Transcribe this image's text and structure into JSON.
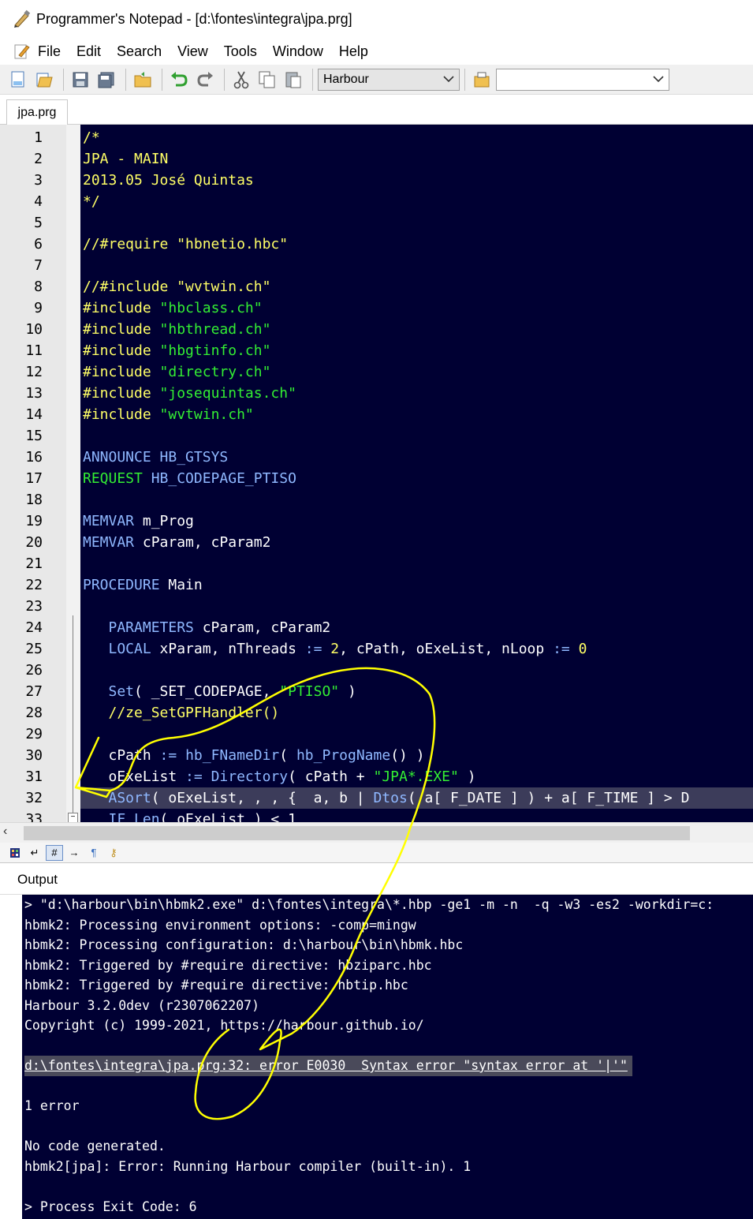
{
  "window": {
    "title": "Programmer's Notepad - [d:\\fontes\\integra\\jpa.prg]"
  },
  "menu": {
    "items": [
      "File",
      "Edit",
      "Search",
      "View",
      "Tools",
      "Window",
      "Help"
    ]
  },
  "toolbar": {
    "scheme_select": "Harbour",
    "second_select": ""
  },
  "tabs": [
    {
      "label": "jpa.prg"
    }
  ],
  "editor": {
    "lines": [
      {
        "n": "1",
        "parts": [
          {
            "t": "/*",
            "c": "comment"
          }
        ]
      },
      {
        "n": "2",
        "parts": [
          {
            "t": "JPA - MAIN",
            "c": "comment"
          }
        ]
      },
      {
        "n": "3",
        "parts": [
          {
            "t": "2013.05 José Quintas",
            "c": "comment"
          }
        ]
      },
      {
        "n": "4",
        "parts": [
          {
            "t": "*/",
            "c": "comment"
          }
        ]
      },
      {
        "n": "5",
        "parts": []
      },
      {
        "n": "6",
        "parts": [
          {
            "t": "//#require \"hbnetio.hbc\"",
            "c": "comment"
          }
        ]
      },
      {
        "n": "7",
        "parts": []
      },
      {
        "n": "8",
        "parts": [
          {
            "t": "//#include \"wvtwin.ch\"",
            "c": "comment"
          }
        ]
      },
      {
        "n": "9",
        "parts": [
          {
            "t": "#include ",
            "c": "comment"
          },
          {
            "t": "\"hbclass.ch\"",
            "c": "str"
          }
        ]
      },
      {
        "n": "10",
        "parts": [
          {
            "t": "#include ",
            "c": "comment"
          },
          {
            "t": "\"hbthread.ch\"",
            "c": "str"
          }
        ]
      },
      {
        "n": "11",
        "parts": [
          {
            "t": "#include ",
            "c": "comment"
          },
          {
            "t": "\"hbgtinfo.ch\"",
            "c": "str"
          }
        ]
      },
      {
        "n": "12",
        "parts": [
          {
            "t": "#include ",
            "c": "comment"
          },
          {
            "t": "\"directry.ch\"",
            "c": "str"
          }
        ]
      },
      {
        "n": "13",
        "parts": [
          {
            "t": "#include ",
            "c": "comment"
          },
          {
            "t": "\"josequintas.ch\"",
            "c": "str"
          }
        ]
      },
      {
        "n": "14",
        "parts": [
          {
            "t": "#include ",
            "c": "comment"
          },
          {
            "t": "\"wvtwin.ch\"",
            "c": "str"
          }
        ]
      },
      {
        "n": "15",
        "parts": []
      },
      {
        "n": "16",
        "parts": [
          {
            "t": "ANNOUNCE ",
            "c": "kw"
          },
          {
            "t": "HB_GTSYS",
            "c": "kw"
          }
        ]
      },
      {
        "n": "17",
        "parts": [
          {
            "t": "REQUEST ",
            "c": "str"
          },
          {
            "t": "HB_CODEPAGE_PTISO",
            "c": "kw"
          }
        ]
      },
      {
        "n": "18",
        "parts": []
      },
      {
        "n": "19",
        "parts": [
          {
            "t": "MEMVAR ",
            "c": "kw"
          },
          {
            "t": "m_Prog",
            "c": "plain"
          }
        ]
      },
      {
        "n": "20",
        "parts": [
          {
            "t": "MEMVAR ",
            "c": "kw"
          },
          {
            "t": "cParam, cParam2",
            "c": "plain"
          }
        ]
      },
      {
        "n": "21",
        "parts": []
      },
      {
        "n": "22",
        "parts": [
          {
            "t": "PROCEDURE ",
            "c": "kw"
          },
          {
            "t": "Main",
            "c": "plain"
          }
        ]
      },
      {
        "n": "23",
        "parts": []
      },
      {
        "n": "24",
        "parts": [
          {
            "t": "   PARAMETERS ",
            "c": "kw"
          },
          {
            "t": "cParam, cParam2",
            "c": "plain"
          }
        ]
      },
      {
        "n": "25",
        "parts": [
          {
            "t": "   LOCAL ",
            "c": "kw"
          },
          {
            "t": "xParam, nThreads ",
            "c": "plain"
          },
          {
            "t": ":= ",
            "c": "kw"
          },
          {
            "t": "2",
            "c": "num"
          },
          {
            "t": ", cPath, oExeList, nLoop ",
            "c": "plain"
          },
          {
            "t": ":= ",
            "c": "kw"
          },
          {
            "t": "0",
            "c": "num"
          }
        ]
      },
      {
        "n": "26",
        "parts": []
      },
      {
        "n": "27",
        "parts": [
          {
            "t": "   Set",
            "c": "kw"
          },
          {
            "t": "( _SET_CODEPAGE, ",
            "c": "plain"
          },
          {
            "t": "\"PTISO\"",
            "c": "str"
          },
          {
            "t": " )",
            "c": "plain"
          }
        ]
      },
      {
        "n": "28",
        "parts": [
          {
            "t": "   //ze_SetGPFHandler()",
            "c": "comment"
          }
        ]
      },
      {
        "n": "29",
        "parts": []
      },
      {
        "n": "30",
        "parts": [
          {
            "t": "   cPath ",
            "c": "plain"
          },
          {
            "t": ":= ",
            "c": "kw"
          },
          {
            "t": "hb_FNameDir",
            "c": "kw"
          },
          {
            "t": "( ",
            "c": "plain"
          },
          {
            "t": "hb_ProgName",
            "c": "kw"
          },
          {
            "t": "() )",
            "c": "plain"
          }
        ]
      },
      {
        "n": "31",
        "parts": [
          {
            "t": "   oExeList ",
            "c": "plain"
          },
          {
            "t": ":= ",
            "c": "kw"
          },
          {
            "t": "Directory",
            "c": "kw"
          },
          {
            "t": "( cPath + ",
            "c": "plain"
          },
          {
            "t": "\"JPA*.EXE\"",
            "c": "str"
          },
          {
            "t": " )",
            "c": "plain"
          }
        ]
      },
      {
        "n": "32",
        "parts": [
          {
            "t": "   ASort",
            "c": "kw"
          },
          {
            "t": "( oExeList, , , {  a, b | ",
            "c": "plain"
          },
          {
            "t": "Dtos",
            "c": "kw"
          },
          {
            "t": "( a[ F_DATE ] ) + a[ F_TIME ] > D",
            "c": "plain"
          }
        ]
      },
      {
        "n": "33",
        "parts": [
          {
            "t": "   IF ",
            "c": "kw"
          },
          {
            "t": "Len",
            "c": "kw"
          },
          {
            "t": "( oExeList ) < 1",
            "c": "plain"
          }
        ]
      }
    ]
  },
  "output_panel": {
    "title": "Output",
    "lines": [
      "> \"d:\\harbour\\bin\\hbmk2.exe\" d:\\fontes\\integra\\*.hbp -ge1 -m -n  -q -w3 -es2 -workdir=c:",
      "hbmk2: Processing environment options: -comp=mingw",
      "hbmk2: Processing configuration: d:\\harbour\\bin\\hbmk.hbc",
      "hbmk2: Triggered by #require directive: hbziparc.hbc",
      "hbmk2: Triggered by #require directive: hbtip.hbc",
      "Harbour 3.2.0dev (r2307062207)",
      "Copyright (c) 1999-2021, https://harbour.github.io/",
      "",
      "d:\\fontes\\integra\\jpa.prg:32: error E0030  Syntax error \"syntax error at '|'\"",
      "",
      "1 error",
      "",
      "No code generated.",
      "hbmk2[jpa]: Error: Running Harbour compiler (built-in). 1",
      "",
      "> Process Exit Code: 6"
    ],
    "error_line_index": 8
  },
  "colors": {
    "editor_bg": "#000033",
    "comment": "#ffff66",
    "string": "#33ee33",
    "keyword": "#8fb8ff",
    "annotation": "#ffff00"
  }
}
